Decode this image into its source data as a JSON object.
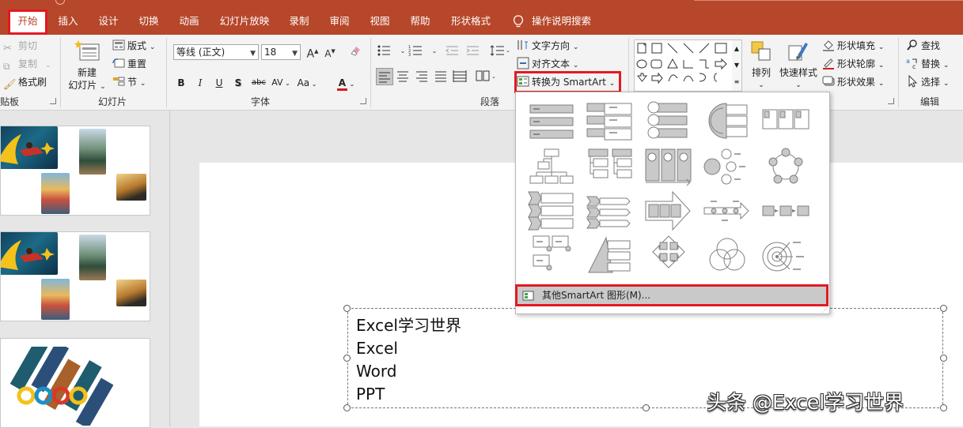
{
  "tabs": [
    {
      "label": "开始",
      "active": true
    },
    {
      "label": "插入"
    },
    {
      "label": "设计"
    },
    {
      "label": "切换"
    },
    {
      "label": "动画"
    },
    {
      "label": "幻灯片放映"
    },
    {
      "label": "录制"
    },
    {
      "label": "审阅"
    },
    {
      "label": "视图"
    },
    {
      "label": "帮助"
    },
    {
      "label": "形状格式"
    },
    {
      "label": "操作说明搜索"
    }
  ],
  "clipboard": {
    "cut": "剪切",
    "copy": "复制",
    "format_painter": "格式刷",
    "label": "贴板"
  },
  "slides": {
    "new_slide": "新建",
    "new_slide2": "幻灯片",
    "layout": "版式",
    "reset": "重置",
    "section": "节",
    "label": "幻灯片"
  },
  "font": {
    "name": "等线 (正文)",
    "size": "18",
    "label": "字体",
    "bold": "B",
    "italic": "I",
    "underline": "U",
    "strike": "S",
    "shadow": "abc",
    "spacing": "AV",
    "case": "Aa",
    "grow": "A",
    "shrink": "A"
  },
  "paragraph": {
    "label": "段落",
    "text_direction": "文字方向",
    "align_text": "对齐文本",
    "convert_smartart": "转换为 SmartArt"
  },
  "drawing": {
    "arrange": "排列",
    "quick_styles": "快速样式",
    "shape_fill": "形状填充",
    "shape_outline": "形状轮廓",
    "shape_effects": "形状效果"
  },
  "editing": {
    "find": "查找",
    "replace": "替换",
    "select": "选择",
    "label": "编辑"
  },
  "smartart_menu": {
    "more": "其他SmartArt 图形(M)..."
  },
  "textbox": {
    "lines": [
      "Excel学习世界",
      "Excel",
      "Word",
      "PPT"
    ]
  },
  "watermark": "头条 @Excel学习世界",
  "colors": {
    "tab_bar": "#b7472a",
    "highlight": "#e11a22",
    "menu_hover": "#c9c9c9"
  }
}
